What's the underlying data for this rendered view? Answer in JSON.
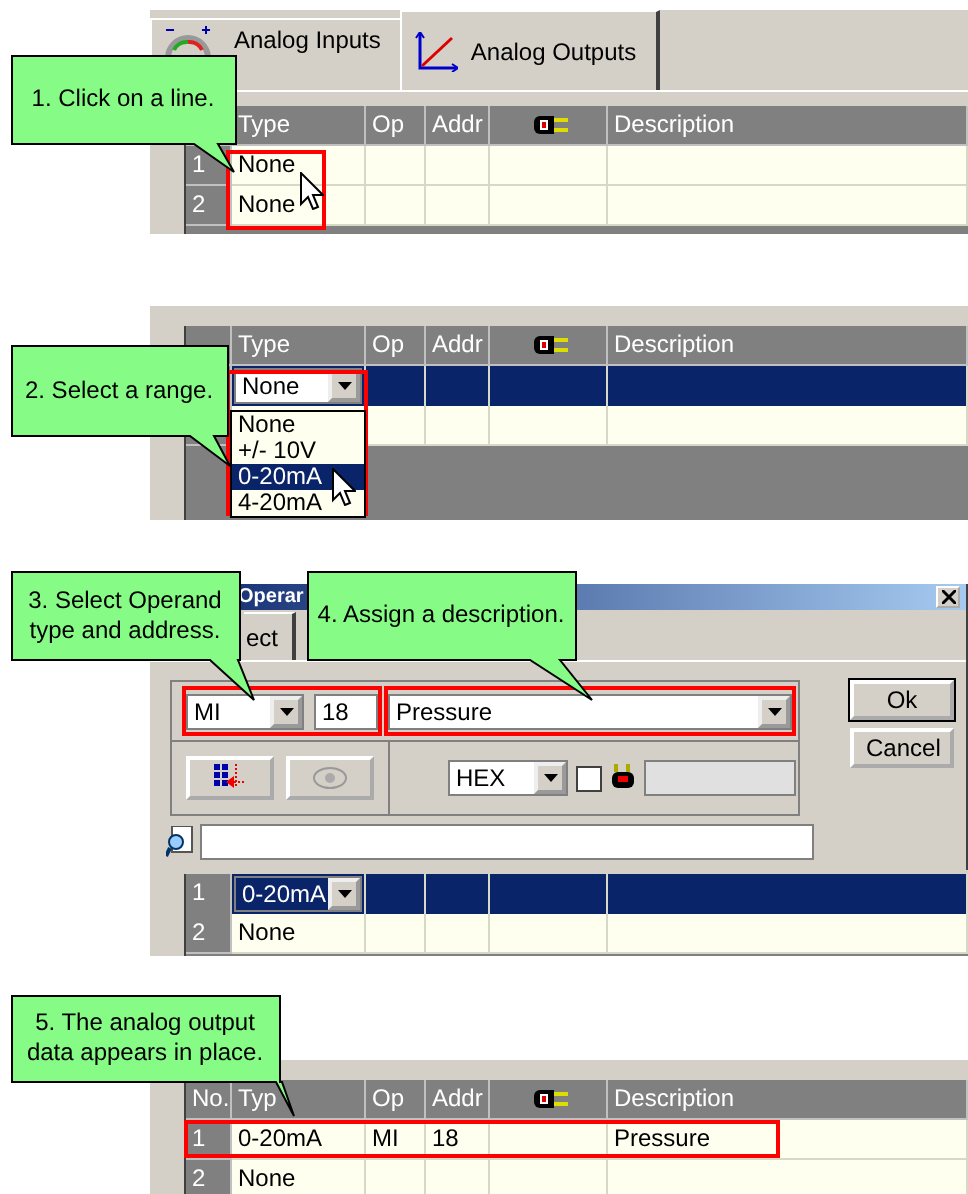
{
  "step_1": {
    "callout": "1. Click on a line.",
    "tabs": [
      {
        "label": "Analog Inputs",
        "selected": false
      },
      {
        "label": "Analog Outputs",
        "selected": true
      }
    ],
    "columns": [
      {
        "kind": "number"
      },
      {
        "kind": "text",
        "label": "Type"
      },
      {
        "kind": "text",
        "label": "Op"
      },
      {
        "kind": "text",
        "label": "Addr"
      },
      {
        "kind": "icon"
      },
      {
        "kind": "text",
        "label": "Description"
      }
    ],
    "rows": [
      {
        "no": "1",
        "type": "None",
        "selected": false
      },
      {
        "no": "2",
        "type": "None",
        "selected": false
      }
    ]
  },
  "step_2": {
    "callout": "2. Select a range.",
    "columns": [
      {
        "kind": "number"
      },
      {
        "kind": "text",
        "label": "Type"
      },
      {
        "kind": "text",
        "label": "Op"
      },
      {
        "kind": "text",
        "label": "Addr"
      },
      {
        "kind": "icon"
      },
      {
        "kind": "text",
        "label": "Description"
      }
    ],
    "rows": [
      {
        "type": "None",
        "selected": true,
        "editing": true,
        "focused": false
      },
      {
        "selected": false
      }
    ],
    "options": [
      {
        "label": "None",
        "selected": false
      },
      {
        "label": "+/- 10V",
        "selected": false
      },
      {
        "label": "0-20mA",
        "selected": true
      },
      {
        "label": "4-20mA",
        "selected": false
      }
    ]
  },
  "step_3": {
    "callouts": [
      "3. Select Operand\ntype and address.",
      "4. Assign a description."
    ],
    "dialog": {
      "title": "Operar",
      "tab": "ect",
      "operand_type": "MI",
      "address": "18",
      "description": "Pressure",
      "format": "HEX",
      "checked": false,
      "buttons": [
        "Ok",
        "Cancel"
      ]
    },
    "rows": [
      {
        "no": "1",
        "type": "0-20mA",
        "selected": true,
        "editing": true,
        "focused": true
      },
      {
        "no": "2",
        "type": "None",
        "selected": false
      }
    ]
  },
  "step_4": {
    "callout": "5. The analog output\ndata appears in place.",
    "columns": [
      {
        "kind": "number",
        "label": "No."
      },
      {
        "kind": "text",
        "label": "Typ"
      },
      {
        "kind": "text",
        "label": "Op"
      },
      {
        "kind": "text",
        "label": "Addr"
      },
      {
        "kind": "icon"
      },
      {
        "kind": "text",
        "label": "Description"
      }
    ],
    "rows": [
      {
        "no": "1",
        "type": "0-20mA",
        "op": "MI",
        "addr": "18",
        "description": "Pressure",
        "selected": false
      },
      {
        "no": "2",
        "type": "None",
        "selected": false
      }
    ]
  }
}
